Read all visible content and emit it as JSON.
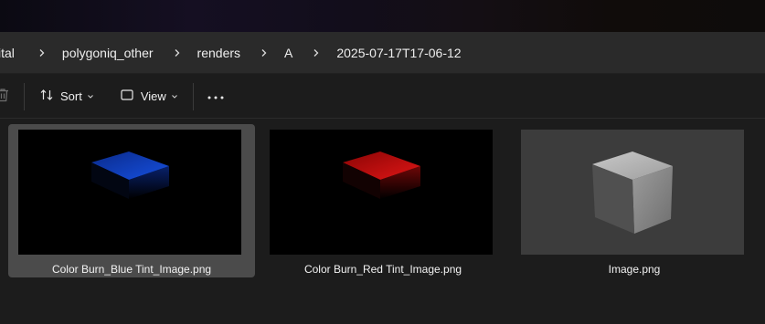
{
  "breadcrumb": {
    "items": [
      {
        "label": "ital"
      },
      {
        "label": "polygoniq_other"
      },
      {
        "label": "renders"
      },
      {
        "label": "A"
      },
      {
        "label": "2025-07-17T17-06-12"
      }
    ]
  },
  "toolbar": {
    "sort_label": "Sort",
    "view_label": "View",
    "delete_icon": "trash-icon",
    "sort_icon": "sort-arrows-icon",
    "view_icon": "view-window-icon",
    "more_icon": "more-options-icon"
  },
  "files": [
    {
      "name": "Color Burn_Blue Tint_Image.png",
      "selected": true,
      "tint": "#1248d4"
    },
    {
      "name": "Color Burn_Red Tint_Image.png",
      "selected": false,
      "tint": "#d01010"
    },
    {
      "name": "Image.png",
      "selected": false,
      "tint": "#9a9a9a"
    }
  ],
  "colors": {
    "background": "#1c1c1c",
    "address_bar": "#2a2a2a",
    "selection": "#4b4b4b"
  }
}
